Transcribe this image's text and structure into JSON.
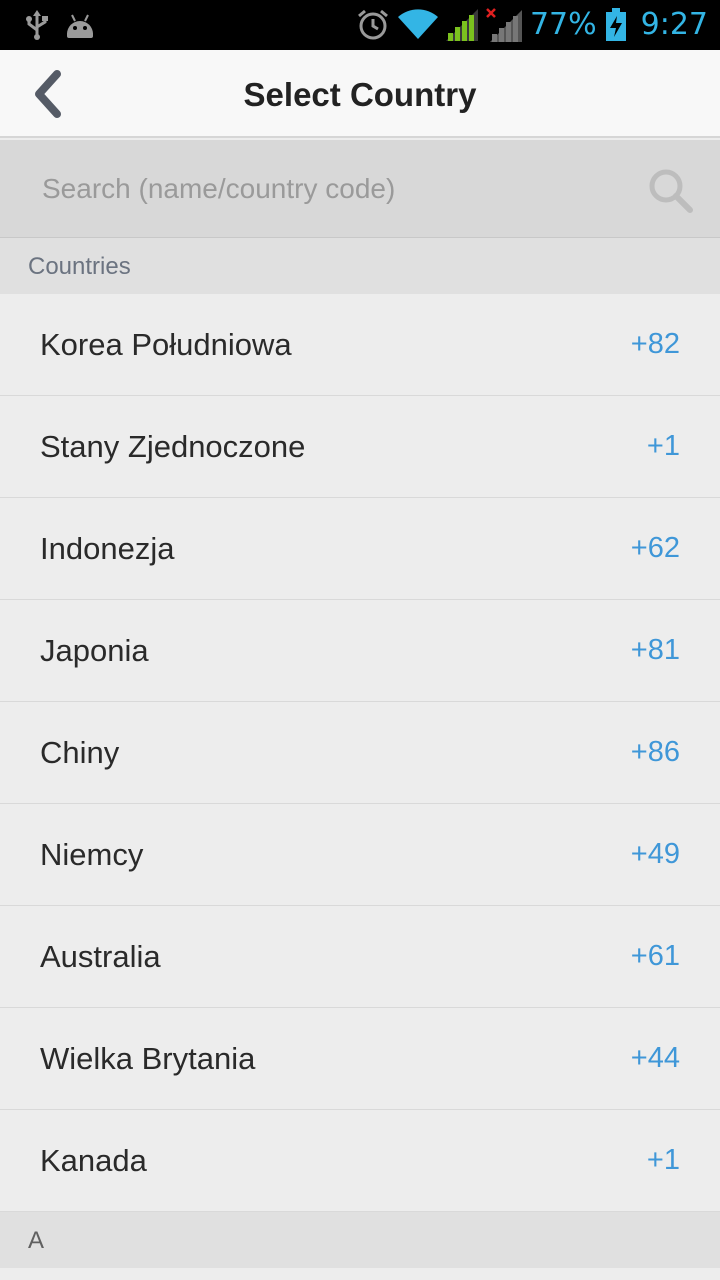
{
  "status_bar": {
    "battery": "77%",
    "time": "9:27",
    "icons": [
      "usb-icon",
      "android-icon",
      "alarm-icon",
      "wifi-icon",
      "signal-icon",
      "signal-no-data-icon",
      "battery-charging-icon"
    ]
  },
  "header": {
    "title": "Select Country",
    "back_icon": "chevron-left-icon"
  },
  "search": {
    "placeholder": "Search (name/country code)",
    "value": "",
    "icon": "search-icon"
  },
  "sections": {
    "countries_header": "Countries",
    "letter_header": "A"
  },
  "countries": [
    {
      "name": "Korea Południowa",
      "code": "+82"
    },
    {
      "name": "Stany Zjednoczone",
      "code": "+1"
    },
    {
      "name": "Indonezja",
      "code": "+62"
    },
    {
      "name": "Japonia",
      "code": "+81"
    },
    {
      "name": "Chiny",
      "code": "+86"
    },
    {
      "name": "Niemcy",
      "code": "+49"
    },
    {
      "name": "Australia",
      "code": "+61"
    },
    {
      "name": "Wielka Brytania",
      "code": "+44"
    },
    {
      "name": "Kanada",
      "code": "+1"
    }
  ],
  "colors": {
    "status_accent": "#33b5e5",
    "code_blue": "#3f97d8",
    "signal_green": "#7bc11e"
  }
}
